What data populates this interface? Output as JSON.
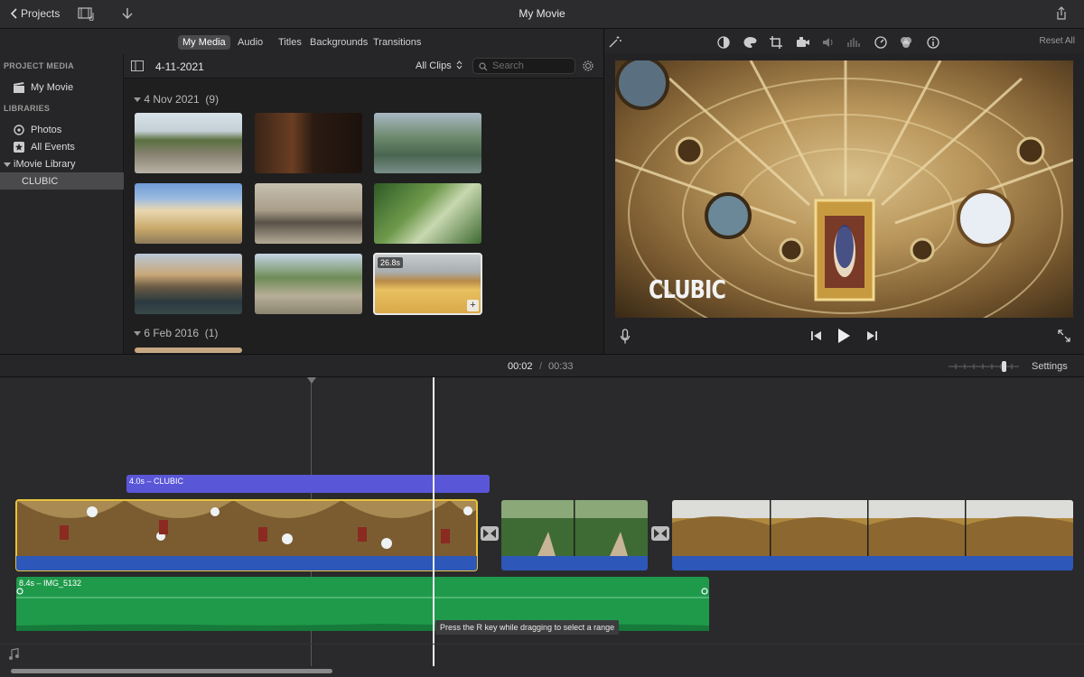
{
  "window": {
    "title": "My Movie",
    "back_label": "Projects"
  },
  "browser_tabs": [
    "My Media",
    "Audio",
    "Titles",
    "Backgrounds",
    "Transitions"
  ],
  "sidebar": {
    "project_media_header": "PROJECT MEDIA",
    "project": "My Movie",
    "libraries_header": "LIBRARIES",
    "photos": "Photos",
    "all_events": "All Events",
    "library": "iMovie Library",
    "event": "CLUBIC"
  },
  "media_bar": {
    "date": "4-11-2021",
    "filter": "All Clips",
    "search_placeholder": "Search"
  },
  "groups": [
    {
      "date": "4 Nov 2021",
      "count": "(9)"
    },
    {
      "date": "6 Feb 2016",
      "count": "(1)"
    }
  ],
  "selected_clip_duration": "26.8s",
  "viewer": {
    "reset_label": "Reset All",
    "overlay_title": "CLUBIC"
  },
  "timebar": {
    "current": "00:02",
    "separator": "/",
    "total": "00:33",
    "settings_label": "Settings"
  },
  "timeline": {
    "title_clip_label": "4.0s – CLUBIC",
    "music_clip_label": "8.4s – IMG_5132",
    "tooltip": "Press the R key while dragging to select a range"
  },
  "colors": {
    "title_clip": "#5a56d8",
    "audio": "#2d57b8",
    "music": "#1f9a4b",
    "selection": "#e8c23a"
  }
}
